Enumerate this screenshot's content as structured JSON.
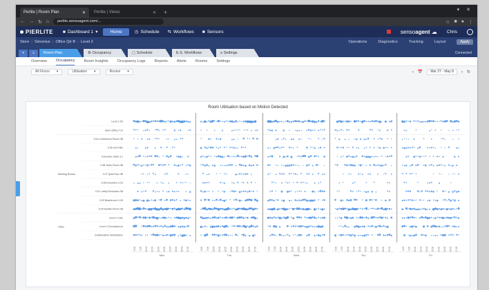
{
  "browser": {
    "tabs": [
      {
        "title": "Perlite | Room Plan",
        "active": true
      },
      {
        "title": "Perlite | Views",
        "active": false
      }
    ],
    "new_tab_label": "+",
    "url": "perlite.sensoagent.com/...",
    "window_controls": "▾ ✕"
  },
  "appnav": {
    "logo": "PIERLITE",
    "dashboard_select": "Dashboard 1",
    "active_item": "Home",
    "items": [
      "Schedule",
      "Workflows",
      "Sensors"
    ],
    "brand_prefix": "senso",
    "brand_strong": "agent",
    "user": "Chris"
  },
  "crumbs": [
    "Store",
    "Simonius",
    "Office Qtr B",
    "Level 2"
  ],
  "toolbar": {
    "items": [
      "Operations",
      "Diagnostics",
      "Tracking",
      "Layout"
    ],
    "button": "Apply"
  },
  "workspace": {
    "home_label": "Room Plan",
    "tabs": [
      "Occupancy",
      "Schedule",
      "E.S. Workflows",
      "Settings"
    ],
    "right_text": "Connected"
  },
  "subtabs": [
    "Overview",
    "Occupancy",
    "Room Insights",
    "Occupancy Logs",
    "Reports",
    "Alerts",
    "Rooms",
    "Settings"
  ],
  "filters": [
    {
      "label": "All Floors",
      "arrow": "▾"
    },
    {
      "label": "Utilisation",
      "arrow": "▾"
    },
    {
      "label": "Rooms",
      "arrow": "▾"
    }
  ],
  "daterange": {
    "calendar": "📅",
    "prev": "‹",
    "next": "›",
    "label": "Mar 27 - May 8",
    "refresh": "↻"
  },
  "icons": {
    "collapse_icon": "«",
    "home_icon": "⌂",
    "app_icon": "■",
    "gear_icon": "⚙",
    "calendar_small_icon": "▢",
    "sliders_icon": "≡"
  },
  "colors": {
    "navy": "#1d2d57",
    "accent": "#4a76c4",
    "tab_active": "#4a9ee8",
    "dot": "#4a90e2"
  },
  "chart_data": {
    "type": "scatter",
    "title": "Room Utilisation based on Motion Detected",
    "groups": [
      {
        "label": "",
        "rows": [
          "Level 2 Kit",
          "Open Office T10"
        ]
      },
      {
        "label": "Meeting Rooms",
        "rows": [
          "3.04 Conference Room 3B",
          "3.05 3rd fl Ble",
          "Executive Suite 3.1",
          "3.3B Team Room 3B",
          "3.07 Quiet Boo 3B",
          "3.08 Executive 3.03",
          "3.01 Lobby Reception 3B",
          "3.02 Boardroom 3.1B",
          "3.09 Huddle Room 3B"
        ]
      },
      {
        "label": "Other",
        "rows": [
          "Level 2 Cafe",
          "Level 2 Circulation Ar",
          "Collaboration Workstation"
        ]
      }
    ],
    "days": [
      "Mon",
      "Tue",
      "Wed",
      "Thu",
      "Fri"
    ],
    "hour_ticks": [
      "8:00",
      "9:00",
      "10:00",
      "11:00",
      "12:00",
      "13:00",
      "14:00",
      "15:00",
      "16:00",
      "17:00"
    ],
    "density": [
      [
        0.9,
        0.85,
        0.9,
        0.8,
        0.75
      ],
      [
        0.45,
        0.35,
        0.5,
        0.4,
        0.3
      ],
      [
        0.35,
        0.5,
        0.4,
        0.45,
        0.3
      ],
      [
        0.4,
        0.55,
        0.5,
        0.45,
        0.5
      ],
      [
        0.6,
        0.7,
        0.65,
        0.6,
        0.55
      ],
      [
        0.55,
        0.6,
        0.55,
        0.6,
        0.5
      ],
      [
        0.35,
        0.45,
        0.4,
        0.35,
        0.3
      ],
      [
        0.3,
        0.4,
        0.35,
        0.3,
        0.35
      ],
      [
        0.45,
        0.55,
        0.6,
        0.5,
        0.55
      ],
      [
        0.7,
        0.75,
        0.7,
        0.65,
        0.6
      ],
      [
        0.9,
        0.9,
        0.85,
        0.85,
        0.8
      ],
      [
        0.85,
        0.8,
        0.8,
        0.8,
        0.75
      ],
      [
        0.75,
        0.8,
        0.75,
        0.7,
        0.7
      ],
      [
        0.7,
        0.75,
        0.7,
        0.65,
        0.65
      ]
    ]
  }
}
